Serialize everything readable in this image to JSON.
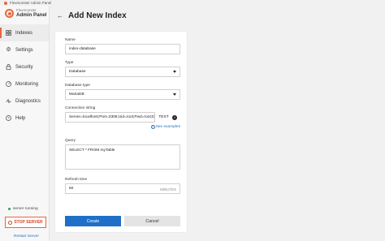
{
  "window": {
    "title": "Flexmonster Admin Panel"
  },
  "brand": {
    "sub": "Flexmonster",
    "name": "Admin Panel"
  },
  "sidebar": {
    "items": [
      {
        "label": "Indexes",
        "icon": "indexes-icon",
        "active": true
      },
      {
        "label": "Settings",
        "icon": "gear-icon"
      },
      {
        "label": "Security",
        "icon": "lock-icon"
      },
      {
        "label": "Monitoring",
        "icon": "monitoring-icon"
      },
      {
        "label": "Diagnostics",
        "icon": "diagnostics-icon"
      },
      {
        "label": "Help",
        "icon": "help-icon"
      }
    ],
    "server_status": "server running",
    "stop_label": "STOP SERVER",
    "restart_label": "Restart Server"
  },
  "header": {
    "title": "Add New Index"
  },
  "form": {
    "name": {
      "label": "Name",
      "value": "index-database"
    },
    "type": {
      "label": "Type",
      "value": "Database"
    },
    "db_type": {
      "label": "Database type",
      "value": "MariaDB"
    },
    "connection": {
      "label": "Connection string",
      "value": "Server=localhost;Port=3306;Uid=root;Pwd=root;Database=db",
      "test_label": "TEST",
      "examples_label": "See examples"
    },
    "query": {
      "label": "Query",
      "value": "SELECT * FROM myTable"
    },
    "refresh": {
      "label": "Refresh time",
      "value": "60",
      "unit": "MINUTES"
    },
    "create_label": "Create",
    "cancel_label": "Cancel"
  },
  "colors": {
    "accent": "#e8673c",
    "primary": "#1f6fc8",
    "link": "#2a6fbf",
    "status": "#2aa34a"
  }
}
